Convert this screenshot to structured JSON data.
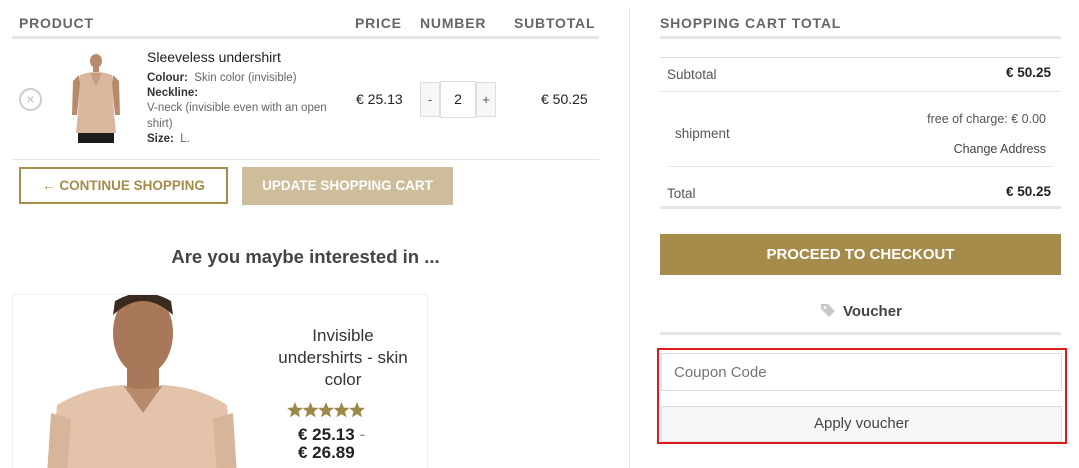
{
  "cart": {
    "headers": {
      "product": "PRODUCT",
      "price": "PRICE",
      "number": "NUMBER",
      "subtotal": "SUBTOTAL"
    },
    "items": [
      {
        "name": "Sleeveless undershirt",
        "attributes": [
          {
            "label": "Colour:",
            "value": "Skin color (invisible)"
          },
          {
            "label": "Neckline:",
            "value": "V-neck (invisible even with an open shirt)"
          },
          {
            "label": "Size:",
            "value": "L."
          }
        ],
        "price": "€ 25.13",
        "quantity": "2",
        "subtotal": "€ 50.25",
        "remove_icon": "close-circle-icon"
      }
    ],
    "continue_label": "← CONTINUE SHOPPING",
    "update_label": "UPDATE SHOPPING CART"
  },
  "recommendations": {
    "heading": "Are you maybe interested in ...",
    "items": [
      {
        "title": "Invisible undershirts - skin color",
        "rating": 5,
        "rating_max": 5,
        "price_from": "€ 25.13",
        "price_separator": "-",
        "price_to": "€ 26.89"
      }
    ]
  },
  "totals": {
    "title": "SHOPPING CART TOTAL",
    "subtotal_label": "Subtotal",
    "subtotal_value": "€ 50.25",
    "shipment_label": "shipment",
    "shipment_value": "free of charge: € 0.00",
    "change_address": "Change Address",
    "total_label": "Total",
    "total_value": "€ 50.25",
    "checkout_label": "PROCEED TO CHECKOUT"
  },
  "voucher": {
    "label": "Voucher",
    "icon": "tag-icon",
    "coupon_placeholder": "Coupon Code",
    "apply_label": "Apply voucher"
  },
  "colors": {
    "accent": "#a68c4a",
    "accent_light": "#cdbd9b",
    "highlight": "#e01b1b"
  }
}
